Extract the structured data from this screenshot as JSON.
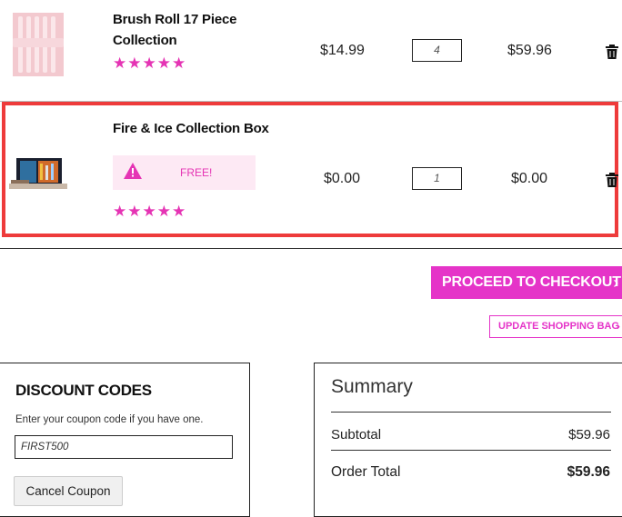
{
  "cart": {
    "items": [
      {
        "name_line1": "Brush Roll 17 Piece",
        "name_line2": "Collection",
        "stars": "★★★★★",
        "price": "$14.99",
        "quantity": "4",
        "total": "$59.96"
      },
      {
        "name_line1": "Fire & Ice Collection Box",
        "promo": "FREE!",
        "stars": "★★★★★",
        "price": "$0.00",
        "quantity": "1",
        "total": "$0.00"
      }
    ]
  },
  "actions": {
    "checkout_label": "PROCEED TO CHECKOUT",
    "checkout_chevron": "›",
    "update_label": "UPDATE SHOPPING BAG",
    "update_chevron": "›"
  },
  "discount": {
    "title": "DISCOUNT CODES",
    "help": "Enter your coupon code if you have one.",
    "code_value": "FIRST500",
    "cancel_label": "Cancel Coupon"
  },
  "summary": {
    "title": "Summary",
    "subtotal_label": "Subtotal",
    "subtotal_value": "$59.96",
    "order_total_label": "Order Total",
    "order_total_value": "$59.96"
  },
  "colors": {
    "accent": "#e534c8",
    "star": "#e534b4",
    "highlight": "#ee3b3b",
    "promo_bg": "#fde9f4"
  }
}
